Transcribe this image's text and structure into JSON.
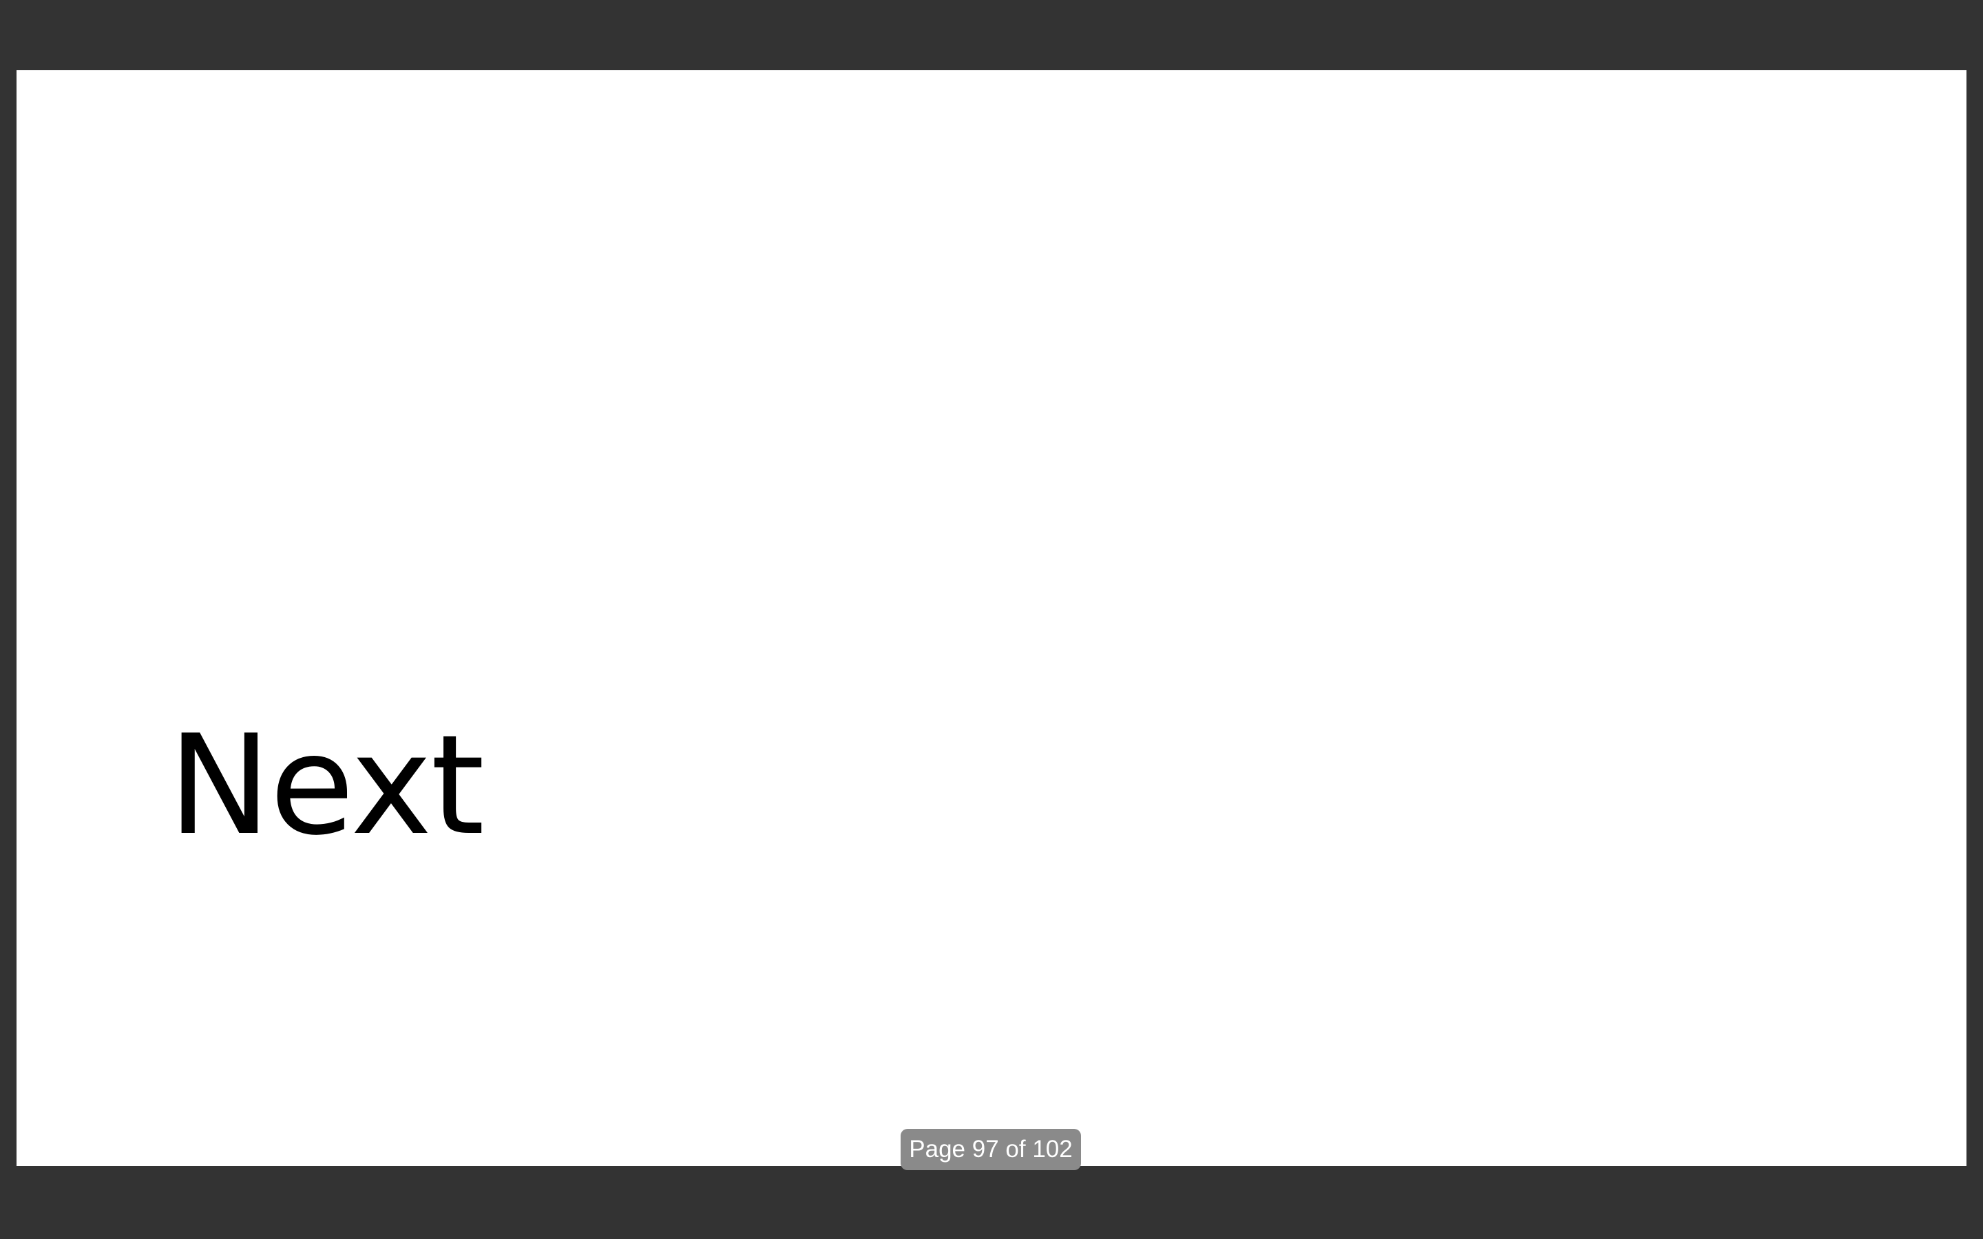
{
  "slide": {
    "title": "Next"
  },
  "page_indicator": {
    "text": "Page 97 of 102",
    "current_page": 97,
    "total_pages": 102
  },
  "colors": {
    "viewer_background": "#333333",
    "slide_background": "#ffffff",
    "indicator_background": "#8a8a8a",
    "title_text": "#000000"
  }
}
